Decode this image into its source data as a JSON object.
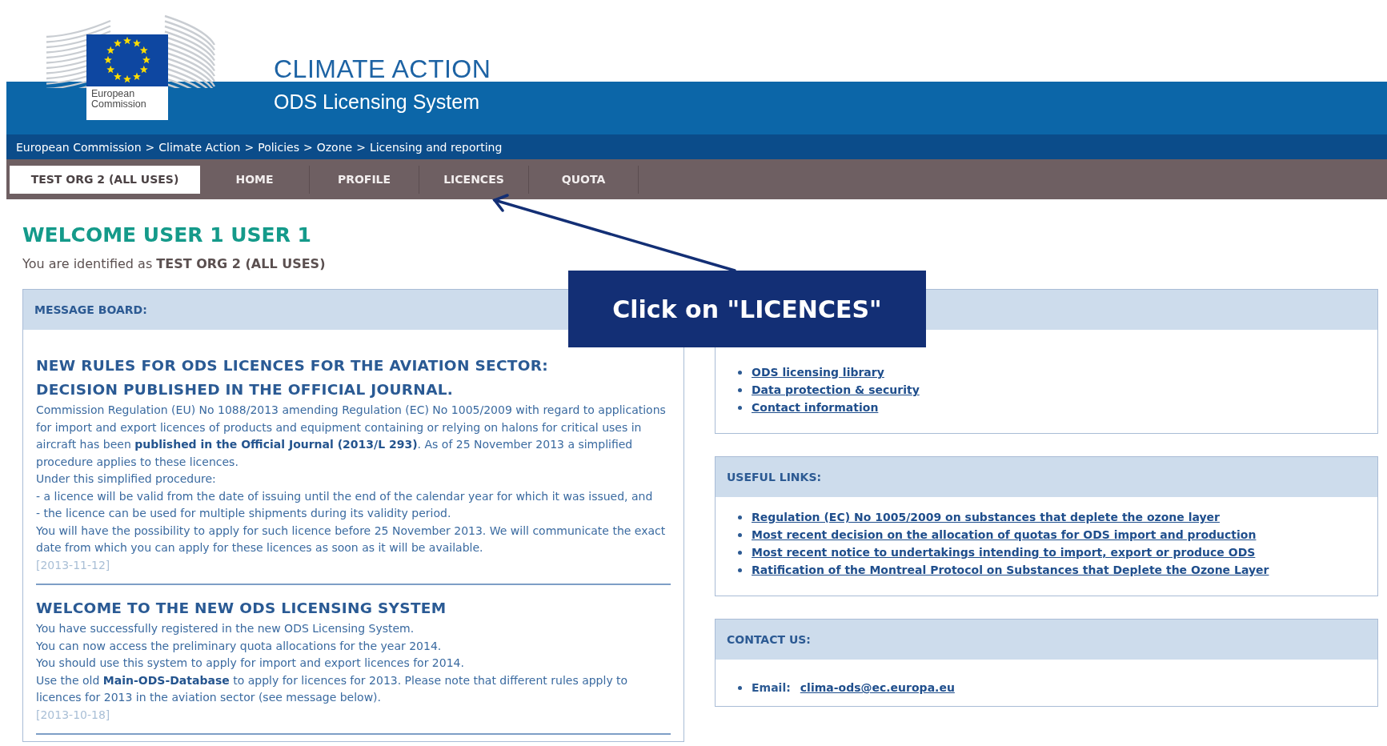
{
  "header": {
    "logo_text": "European Commission",
    "title": "CLIMATE ACTION",
    "subtitle": "ODS Licensing System"
  },
  "breadcrumb": {
    "separator": ">",
    "items": [
      "European Commission",
      "Climate Action",
      "Policies",
      "Ozone",
      "Licensing and reporting"
    ]
  },
  "nav": [
    {
      "label": "TEST ORG 2 (ALL USES)",
      "selected": true
    },
    {
      "label": "HOME",
      "selected": false
    },
    {
      "label": "PROFILE",
      "selected": false
    },
    {
      "label": "LICENCES",
      "selected": false
    },
    {
      "label": "QUOTA",
      "selected": false
    }
  ],
  "welcome": {
    "title": "WELCOME USER 1 USER 1",
    "identified": "You are identified as **TEST ORG 2 (ALL USES)**"
  },
  "message_board": {
    "title": "MESSAGE BOARD:",
    "messages": [
      {
        "title": "NEW RULES FOR ODS LICENCES FOR THE AVIATION SECTOR: DECISION PUBLISHED IN THE OFFICIAL JOURNAL.",
        "paragraphs": [
          "Commission Regulation (EU) No 1088/2013 amending Regulation (EC) No 1005/2009 with regard to applications for import and export licences of products and equipment containing or relying on halons for critical uses in aircraft has been **published in the Official Journal (2013/L 293)**. As of 25 November 2013 a simplified procedure applies to these licences.",
          "Under this simplified procedure:",
          "- a licence will be valid from the date of issuing until the end of the calendar year for which it was issued, and",
          "- the licence can be used for multiple shipments during its validity period.",
          "You will have the possibility to apply for such licence before 25 November 2013. We will communicate the exact date from which you can apply for these licences as soon as it will be available."
        ],
        "date": "[2013-11-12]"
      },
      {
        "title": "WELCOME TO THE NEW ODS LICENSING SYSTEM",
        "paragraphs": [
          "You have successfully registered in the new ODS Licensing System.",
          "You can now access the preliminary quota allocations for the year 2014.",
          "You should use this system to apply for import and export licences for 2014.",
          "Use the old **Main-ODS-Database** to apply for licences for 2013. Please note that different rules apply to licences for 2013 in the aviation sector (see message below)."
        ],
        "date": "[2013-10-18]"
      }
    ]
  },
  "side_panels": [
    {
      "kind": "links",
      "links": [
        "ODS licensing library",
        "Data protection & security",
        "Contact information"
      ]
    },
    {
      "kind": "links",
      "title": "USEFUL LINKS:",
      "links": [
        "Regulation (EC) No 1005/2009 on substances that deplete the ozone layer",
        "Most recent decision on the allocation of quotas for ODS import and production",
        "Most recent notice to undertakings intending to import, export or produce ODS",
        "Ratification of the Montreal Protocol on Substances that Deplete the Ozone Layer"
      ]
    },
    {
      "kind": "contact",
      "title": "CONTACT US:",
      "label": "Email:",
      "email": "clima-ods@ec.europa.eu"
    }
  ],
  "callout": {
    "text": "Click on \"LICENCES\""
  }
}
